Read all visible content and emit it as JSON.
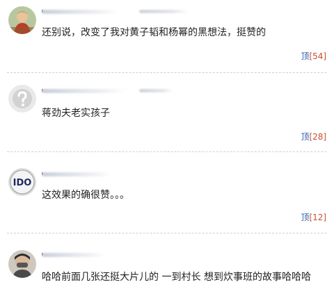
{
  "comments": [
    {
      "text": "还别说，改变了我对黄子韬和杨幂的黑想法，挺赞的",
      "vote_label": "顶",
      "vote_count": "[54]",
      "avatar_icon": "user-avatar-icon"
    },
    {
      "text": "蒋劲夫老实孩子",
      "vote_label": "顶",
      "vote_count": "[28]",
      "avatar_icon": "default-avatar-question-icon"
    },
    {
      "text": "这效果的确很赞。。。",
      "vote_label": "顶",
      "vote_count": "[12]",
      "avatar_icon": "ido-logo-avatar-icon"
    },
    {
      "text": "哈哈前面几张还挺大片儿的 一到村长 想到炊事班的故事哈哈哈",
      "vote_label": "",
      "vote_count": "",
      "avatar_icon": "user-photo-avatar-icon"
    }
  ],
  "colors": {
    "vote_link": "#2a5db0",
    "vote_count": "#c84e2c",
    "divider": "#cfcfcf"
  }
}
